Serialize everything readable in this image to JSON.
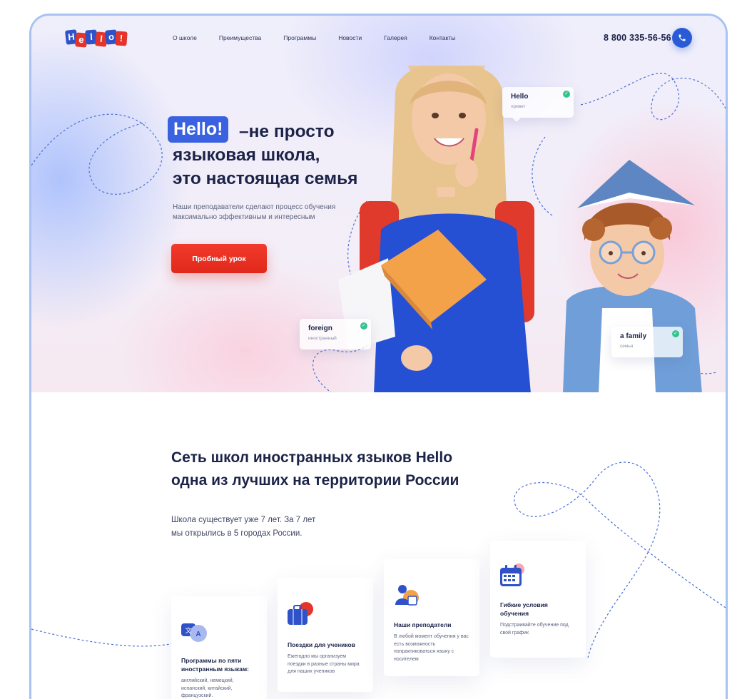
{
  "header": {
    "logo_letters": [
      "H",
      "e",
      "l",
      "l",
      "o",
      "!"
    ],
    "nav": [
      "О школе",
      "Преимущества",
      "Программы",
      "Новости",
      "Галерея",
      "Контакты"
    ],
    "phone": "8 800 335-56-56"
  },
  "hero": {
    "badge": "Hello!",
    "title_line1": "–не просто",
    "title_line2": "языковая школа,",
    "title_line3": "это настоящая семья",
    "subtitle": "Наши преподаватели сделают процесс обучения максимально эффективным и интересным",
    "cta": "Пробный урок"
  },
  "word_cards": [
    {
      "word": "Hello",
      "translation": "привет"
    },
    {
      "word": "foreign",
      "translation": "иностранный"
    },
    {
      "word": "a family",
      "translation": "семья"
    }
  ],
  "about": {
    "title_line1": "Сеть школ иностранных языков Hello",
    "title_line2": "одна из лучших на территории России",
    "text_line1": "Школа существует уже 7 лет. За 7 лет",
    "text_line2": "мы открылись в 5 городах России."
  },
  "features": [
    {
      "icon": "translate-icon",
      "title": "Программы по пяти иностранным языкам:",
      "text": "английский, немецкий, испанский, китайский, французский."
    },
    {
      "icon": "suitcase-icon",
      "title": "Поездки для учеников",
      "text": "Ежегодно мы организуем поездки в разные страны мира для наших учеников"
    },
    {
      "icon": "teacher-icon",
      "title": "Наши преподатели",
      "text": "В любой момент обучения у вас есть возможность попрактиковаться языку с носителем"
    },
    {
      "icon": "calendar-icon",
      "title": "Гибкие условия обучения",
      "text": "Подстраивайте обучение под свой график"
    }
  ],
  "colors": {
    "accent_blue": "#2a5bd7",
    "cta_red": "#e8301f",
    "text_dark": "#1c2348",
    "frame_border": "#a8c2f2"
  }
}
